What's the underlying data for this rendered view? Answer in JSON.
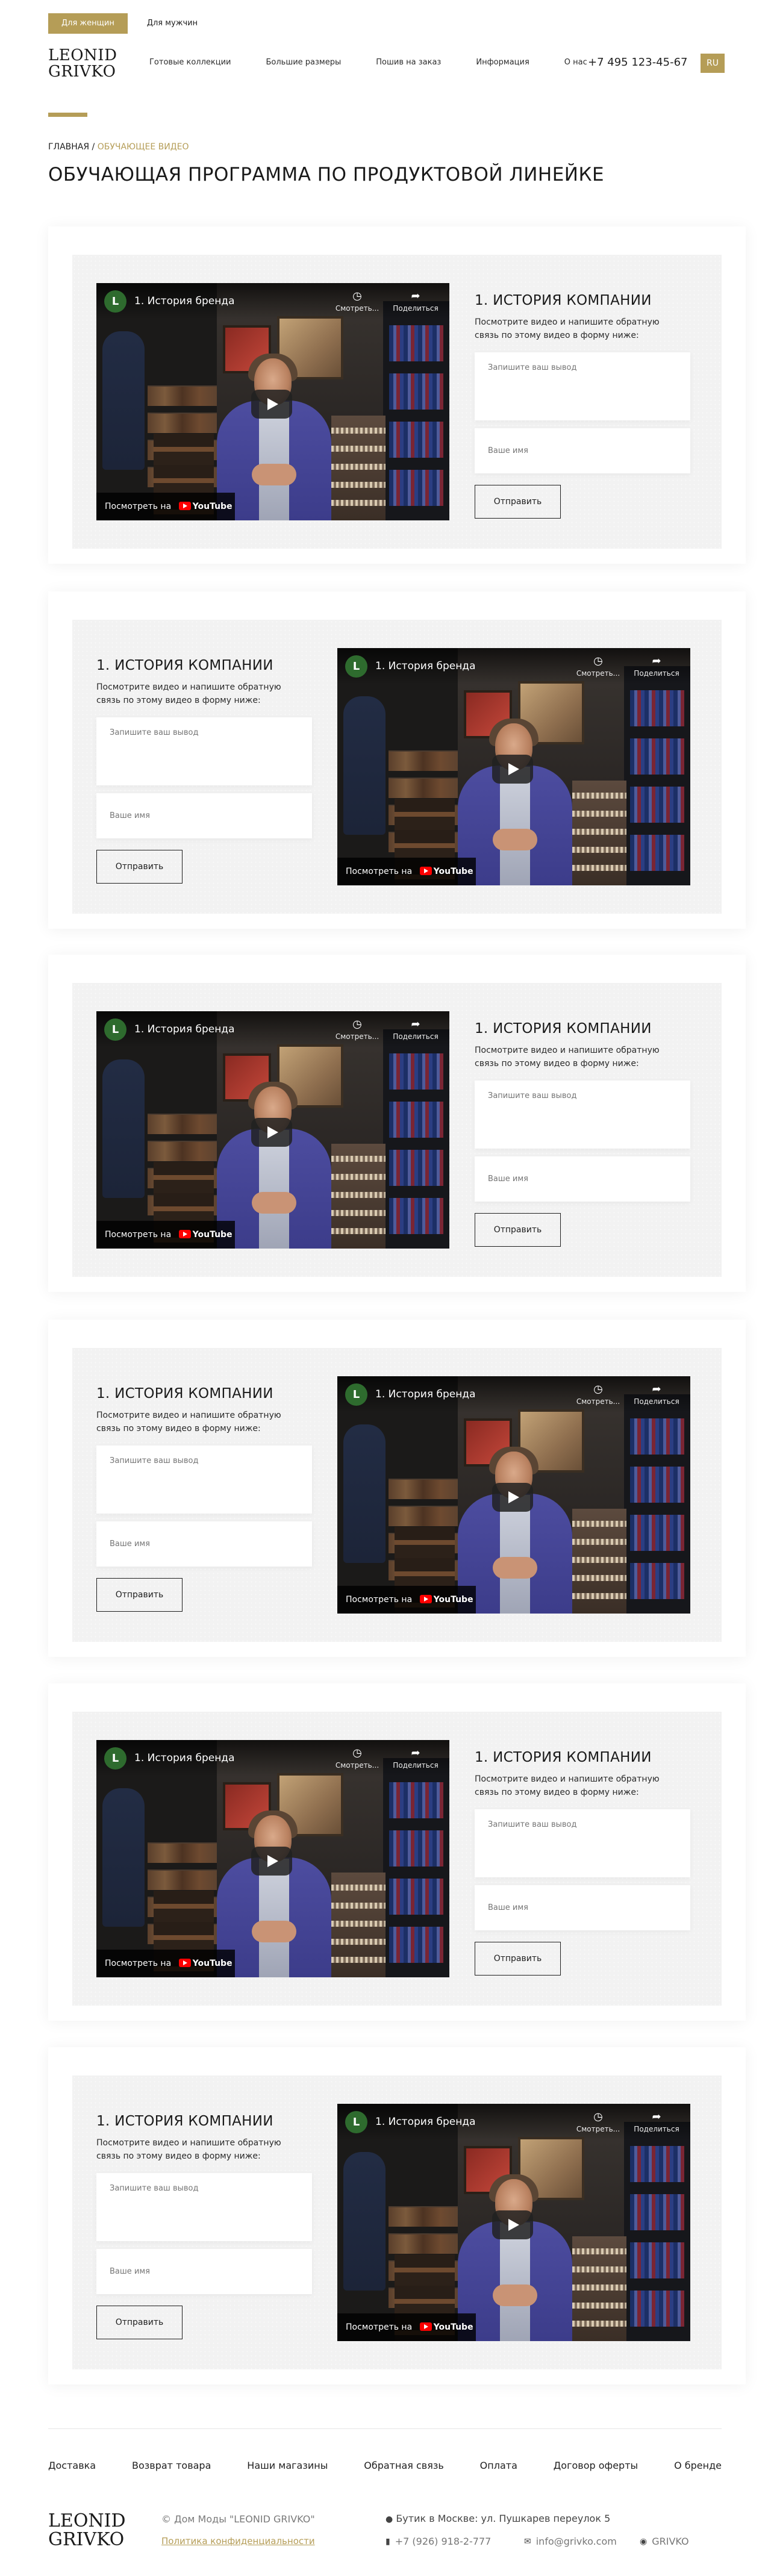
{
  "header": {
    "gender_tabs": [
      "Для женщин",
      "Для мужчин"
    ],
    "logo": [
      "LEONID",
      "GRIVKO"
    ],
    "nav": [
      "Готовые коллекции",
      "Большие размеры",
      "Пошив на заказ",
      "Информация",
      "О нас"
    ],
    "phone": "+7 495 123-45-67",
    "lang": "RU"
  },
  "breadcrumb": {
    "home": "ГЛАВНАЯ",
    "separator": " / ",
    "current": "ОБУЧАЮЩЕЕ ВИДЕО"
  },
  "page_title": "ОБУЧАЮЩАЯ ПРОГРАММА ПО ПРОДУКТОВОЙ ЛИНЕЙКЕ",
  "sections": [
    {
      "title": "1. ИСТОРИЯ КОМПАНИИ",
      "description": "Посмотрите видео и напишите обратную связь по этому видео в форму ниже:",
      "textarea_placeholder": "Запишите ваш вывод",
      "name_placeholder": "Ваше имя",
      "submit": "Отправить",
      "video": {
        "channel_initial": "L",
        "title": "1. История бренда",
        "watch_later": "Смотреть...",
        "share": "Поделиться",
        "watch_on": "Посмотреть на",
        "platform": "YouTube"
      }
    }
  ],
  "footer": {
    "nav": [
      "Доставка",
      "Возврат товара",
      "Наши магазины",
      "Обратная связь",
      "Оплата",
      "Договор оферты",
      "О бренде"
    ],
    "logo": [
      "LEONID",
      "GRIVKO"
    ],
    "copyright": "© Дом Моды \"LEONID GRIVKO\"",
    "privacy": "Политика конфиденциальности",
    "address": "Бутик в Москве: ул. Пушкарев переулок 5",
    "phone": "+7 (926) 918-2-777",
    "email": "info@grivko.com",
    "instagram": "GRIVKO"
  },
  "colors": {
    "accent": "#b59d57"
  }
}
